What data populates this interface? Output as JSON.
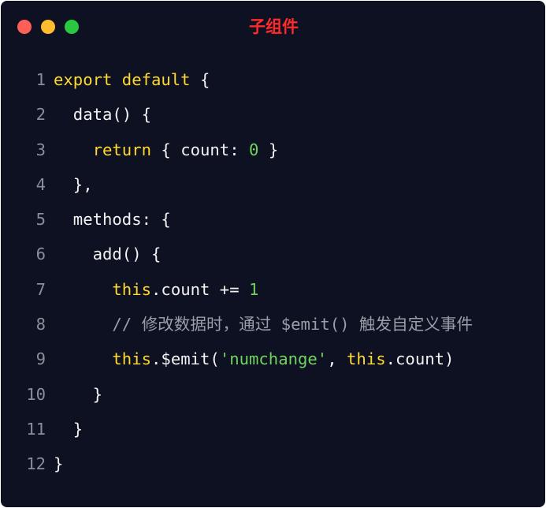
{
  "window": {
    "title": "子组件",
    "colors": {
      "background": "#0e1122",
      "title": "#ff2a2a",
      "close": "#fe5f57",
      "minimize": "#febc2e",
      "maximize": "#28c840"
    }
  },
  "syntax_colors": {
    "keyword": "#ffd92e",
    "plain": "#f2f2f2",
    "number": "#6fd35e",
    "string": "#6fd35e",
    "comment": "#9a9ea8",
    "line_number": "#8a8e99"
  },
  "code": {
    "language": "javascript",
    "lines": [
      {
        "number": "1",
        "tokens": [
          {
            "text": "export default",
            "type": "keyword"
          },
          {
            "text": " {",
            "type": "plain"
          }
        ]
      },
      {
        "number": "2",
        "tokens": [
          {
            "text": "  data() {",
            "type": "plain"
          }
        ]
      },
      {
        "number": "3",
        "tokens": [
          {
            "text": "    ",
            "type": "plain"
          },
          {
            "text": "return",
            "type": "keyword"
          },
          {
            "text": " { count: ",
            "type": "plain"
          },
          {
            "text": "0",
            "type": "number"
          },
          {
            "text": " }",
            "type": "plain"
          }
        ]
      },
      {
        "number": "4",
        "tokens": [
          {
            "text": "  },",
            "type": "plain"
          }
        ]
      },
      {
        "number": "5",
        "tokens": [
          {
            "text": "  methods: {",
            "type": "plain"
          }
        ]
      },
      {
        "number": "6",
        "tokens": [
          {
            "text": "    add() {",
            "type": "plain"
          }
        ]
      },
      {
        "number": "7",
        "tokens": [
          {
            "text": "      ",
            "type": "plain"
          },
          {
            "text": "this",
            "type": "keyword"
          },
          {
            "text": ".count += ",
            "type": "plain"
          },
          {
            "text": "1",
            "type": "number"
          }
        ]
      },
      {
        "number": "8",
        "tokens": [
          {
            "text": "      // 修改数据时，通过 $emit() 触发自定义事件",
            "type": "comment"
          }
        ]
      },
      {
        "number": "9",
        "tokens": [
          {
            "text": "      ",
            "type": "plain"
          },
          {
            "text": "this",
            "type": "keyword"
          },
          {
            "text": ".$emit(",
            "type": "plain"
          },
          {
            "text": "'numchange'",
            "type": "string"
          },
          {
            "text": ", ",
            "type": "plain"
          },
          {
            "text": "this",
            "type": "keyword"
          },
          {
            "text": ".count)",
            "type": "plain"
          }
        ]
      },
      {
        "number": "10",
        "tokens": [
          {
            "text": "    }",
            "type": "plain"
          }
        ]
      },
      {
        "number": "11",
        "tokens": [
          {
            "text": "  }",
            "type": "plain"
          }
        ]
      },
      {
        "number": "12",
        "tokens": [
          {
            "text": "}",
            "type": "plain"
          }
        ]
      }
    ]
  }
}
